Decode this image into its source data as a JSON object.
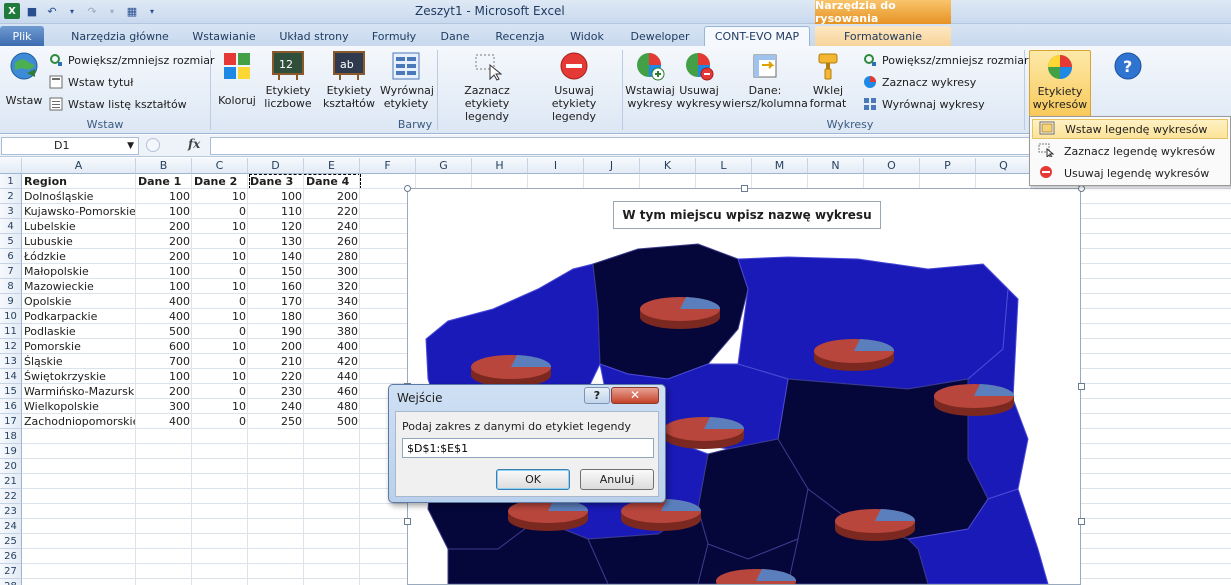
{
  "window": {
    "title": "Zeszyt1 - Microsoft Excel",
    "contextual_header": "Narzędzia do rysowania",
    "app_icon": "excel-icon"
  },
  "tabs": [
    {
      "label": "Plik"
    },
    {
      "label": "Narzędzia główne"
    },
    {
      "label": "Wstawianie"
    },
    {
      "label": "Układ strony"
    },
    {
      "label": "Formuły"
    },
    {
      "label": "Dane"
    },
    {
      "label": "Recenzja"
    },
    {
      "label": "Widok"
    },
    {
      "label": "Deweloper"
    },
    {
      "label": "CONT-EVO MAP"
    },
    {
      "label": "Formatowanie"
    }
  ],
  "ribbon": {
    "wstaw": {
      "big": "Wstaw",
      "resize": "Powiększ/zmniejsz rozmiar",
      "title": "Wstaw tytuł",
      "shapes": "Wstaw listę kształtów",
      "group": "Wstaw"
    },
    "barwy": {
      "koloruj": "Koloruj",
      "etyk_liczbowe": "Etykiety liczbowe",
      "etyk_ksztaltow": "Etykiety kształtów",
      "wyrownaj": "Wyrównaj etykiety",
      "zaznacz_leg": "Zaznacz etykiety legendy",
      "usuwaj_leg": "Usuwaj etykiety legendy",
      "group": "Barwy"
    },
    "wykresy": {
      "wstawiaj": "Wstawiaj wykresy",
      "usuwaj": "Usuwaj wykresy",
      "dane": "Dane: wiersz/kolumna",
      "wklej": "Wklej format",
      "resize": "Powiększ/zmniejsz rozmiar",
      "zaznacz": "Zaznacz wykresy",
      "wyrownaj": "Wyrównaj wykresy",
      "group": "Wykresy"
    },
    "etykiety_wykresow": "Etykiety wykresów"
  },
  "dropdown": [
    {
      "label": "Wstaw legendę wykresów"
    },
    {
      "label": "Zaznacz legendę wykresów"
    },
    {
      "label": "Usuwaj legendę wykresów"
    }
  ],
  "formula_bar": {
    "name_box": "D1",
    "fx": "fx",
    "value": ""
  },
  "columns": [
    "A",
    "B",
    "C",
    "D",
    "E",
    "F",
    "G",
    "H",
    "I",
    "J",
    "K",
    "L",
    "M",
    "N",
    "O",
    "P",
    "Q"
  ],
  "headers": [
    "Region",
    "Dane 1",
    "Dane 2",
    "Dane 3",
    "Dane 4"
  ],
  "rows": [
    [
      "Dolnośląskie",
      "100",
      "10",
      "100",
      "200"
    ],
    [
      "Kujawsko-Pomorskie",
      "100",
      "0",
      "110",
      "220"
    ],
    [
      "Lubelskie",
      "200",
      "10",
      "120",
      "240"
    ],
    [
      "Lubuskie",
      "200",
      "0",
      "130",
      "260"
    ],
    [
      "Łódzkie",
      "200",
      "10",
      "140",
      "280"
    ],
    [
      "Małopolskie",
      "100",
      "0",
      "150",
      "300"
    ],
    [
      "Mazowieckie",
      "100",
      "10",
      "160",
      "320"
    ],
    [
      "Opolskie",
      "400",
      "0",
      "170",
      "340"
    ],
    [
      "Podkarpackie",
      "400",
      "10",
      "180",
      "360"
    ],
    [
      "Podlaskie",
      "500",
      "0",
      "190",
      "380"
    ],
    [
      "Pomorskie",
      "600",
      "10",
      "200",
      "400"
    ],
    [
      "Śląskie",
      "700",
      "0",
      "210",
      "420"
    ],
    [
      "Świętokrzyskie",
      "100",
      "10",
      "220",
      "440"
    ],
    [
      "Warmińsko-Mazurskie",
      "200",
      "0",
      "230",
      "460"
    ],
    [
      "Wielkopolskie",
      "300",
      "10",
      "240",
      "480"
    ],
    [
      "Zachodniopomorskie",
      "400",
      "0",
      "250",
      "500"
    ]
  ],
  "chart": {
    "title": "W tym miejscu wpisz nazwę wykresu",
    "colors": {
      "dark": "#05063a",
      "blue": "#1a1ab8",
      "pie_red": "#b8463c",
      "pie_blue": "#5b7fbd"
    }
  },
  "dialog": {
    "title": "Wejście",
    "help": "?",
    "close": "✕",
    "prompt": "Podaj zakres z danymi do etykiet legendy",
    "value": "$D$1:$E$1",
    "ok": "OK",
    "cancel": "Anuluj"
  }
}
